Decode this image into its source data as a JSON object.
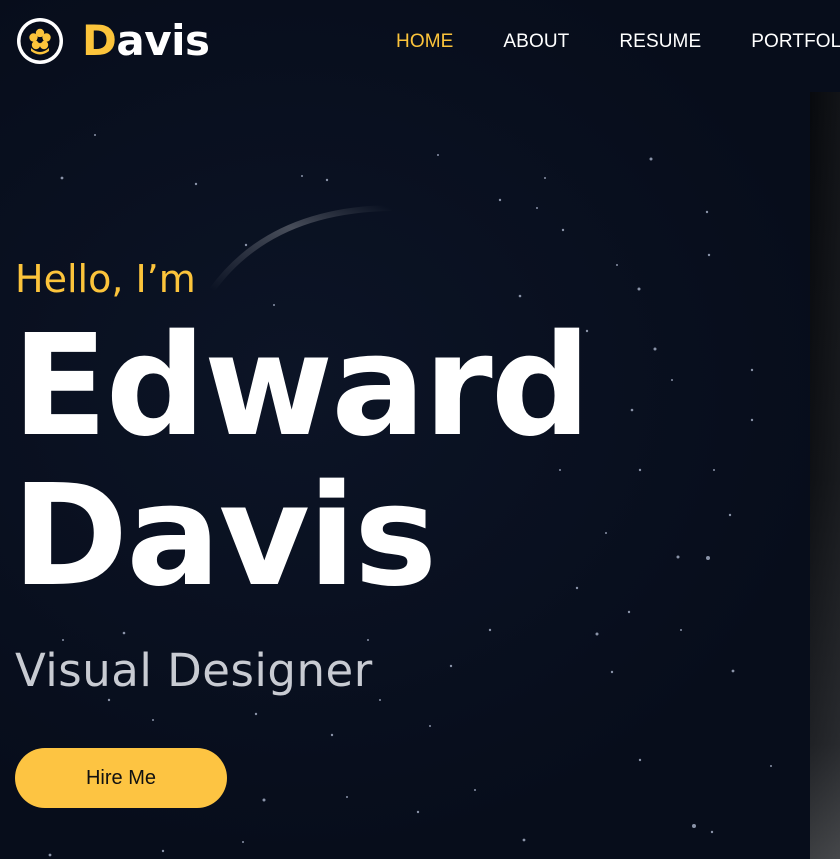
{
  "brand": {
    "initial": "D",
    "rest": "avis",
    "accent_color": "#fcc43b",
    "icon": "flower-badge-icon"
  },
  "nav": {
    "items": [
      {
        "label": "HOME",
        "active": true
      },
      {
        "label": "ABOUT",
        "active": false
      },
      {
        "label": "RESUME",
        "active": false
      },
      {
        "label": "PORTFOLI",
        "active": false
      }
    ]
  },
  "hero": {
    "greeting": "Hello, I’m",
    "first_name": "Edward",
    "last_name": "Davis",
    "role": "Visual Designer",
    "cta_label": "Hire Me",
    "cta_color": "#fdc442"
  },
  "theme": {
    "background": "#070d1b",
    "text": "#ffffff",
    "muted_text": "#c8cbd2"
  }
}
